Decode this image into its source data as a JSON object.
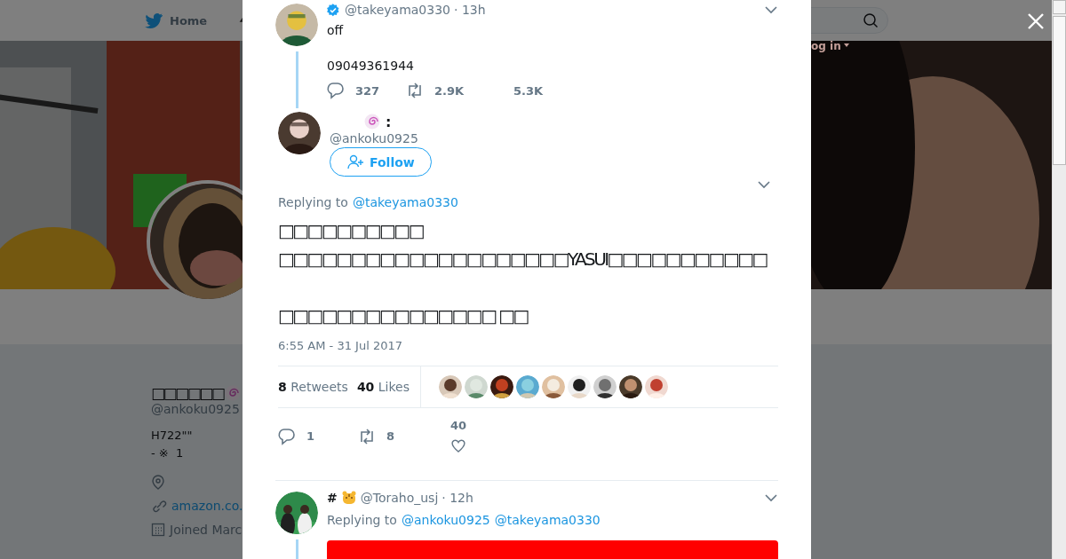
{
  "page": {
    "nav_home": "Home",
    "login": "og in",
    "profile": {
      "name": "□□□□□□",
      "handle": "@ankoku0925",
      "bio": [
        "H722\"\"",
        "- ※  1"
      ],
      "link": "amazon.co.",
      "joined": "Joined Marc"
    }
  },
  "parent_tweet": {
    "verified": true,
    "handle": "@takeyama0330",
    "time": "· 13h",
    "lines": [
      "off",
      "09049361944"
    ],
    "replies": "327",
    "retweets": "2.9K",
    "likes": "5.3K"
  },
  "main_tweet": {
    "name_suffix": ":",
    "handle": "@ankoku0925",
    "follow": "Follow",
    "replying_label": "Replying to",
    "replying_to": [
      "@takeyama0330"
    ],
    "text": "□□□□□□□□□□\n□□□□□□□□□□□□□□□□□□□□YASUI□□□□□□□□□□□\n\n□□□□□□□□□□□□□□□ □□",
    "timestamp": "6:55 AM - 31 Jul 2017",
    "retweet_count": "8",
    "retweet_label": "Retweets",
    "like_count": "40",
    "like_label": "Likes",
    "liker_avatars": [
      {
        "kind": "picture"
      },
      {
        "kind": "picture"
      },
      {
        "kind": "picture"
      },
      {
        "kind": "picture"
      },
      {
        "kind": "picture"
      },
      {
        "kind": "picture"
      },
      {
        "kind": "picture"
      },
      {
        "kind": "picture"
      },
      {
        "kind": "picture"
      }
    ],
    "replies": "1",
    "retweets": "8",
    "likes": "40"
  },
  "reply_tweet": {
    "name": "#",
    "handle": "@Toraho_usj",
    "time": "· 12h",
    "replying_label": "Replying to",
    "replying_to": [
      "@ankoku0925",
      "@takeyama0330"
    ]
  }
}
